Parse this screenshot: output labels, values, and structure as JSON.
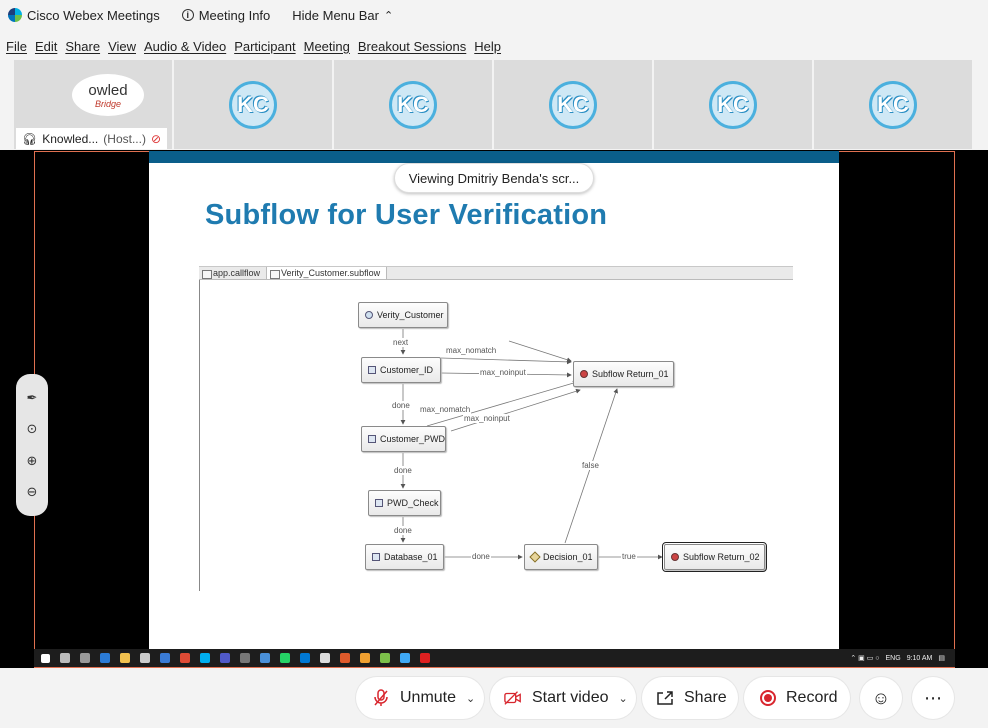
{
  "titlebar": {
    "app_name": "Cisco Webex Meetings",
    "meeting_info": "Meeting Info",
    "hide_menu": "Hide Menu Bar"
  },
  "menu": [
    "File",
    "Edit",
    "Share",
    "View",
    "Audio & Video",
    "Participant",
    "Meeting",
    "Breakout Sessions",
    "Help"
  ],
  "participants": {
    "host_name": "Knowled...",
    "host_role": "(Host...)",
    "host_logo_text": "owled",
    "host_logo_sub": "Bridge",
    "avatar_initials": "KC"
  },
  "share": {
    "viewing_banner": "Viewing Dmitriy Benda's scr...",
    "slide_title": "Subflow for User Verification",
    "tabs": [
      "app.callflow",
      "Verity_Customer.subflow"
    ],
    "nodes": {
      "start": "Verity_Customer",
      "customer_id": "Customer_ID",
      "customer_pwd": "Customer_PWD",
      "pwd_check": "PWD_Check",
      "database": "Database_01",
      "decision": "Decision_01",
      "return1": "Subflow Return_01",
      "return2": "Subflow Return_02"
    },
    "edge_labels": {
      "next": "next",
      "max_nomatch_1": "max_nomatch",
      "max_noinput_1": "max_noinput",
      "done_1": "done",
      "max_nomatch_2": "max_nomatch",
      "max_noinput_2": "max_noinput",
      "done_2": "done",
      "done_3": "done",
      "done_4": "done",
      "false": "false",
      "true": "true"
    }
  },
  "taskbar": {
    "lang": "ENG",
    "time": "9:10 AM"
  },
  "controls": {
    "unmute": "Unmute",
    "start_video": "Start video",
    "share": "Share",
    "record": "Record"
  },
  "colors": {
    "slide_band": "#0a5e8a",
    "slide_title": "#1f7bb0",
    "record_red": "#d8262e",
    "share_border": "#e07050"
  }
}
